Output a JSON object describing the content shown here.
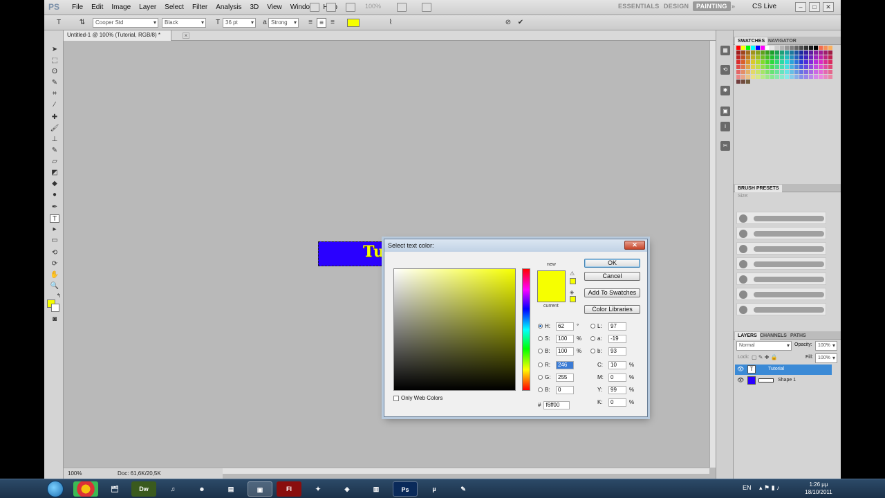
{
  "app": {
    "logo": "PS",
    "menu": [
      "File",
      "Edit",
      "Image",
      "Layer",
      "Select",
      "Filter",
      "Analysis",
      "3D",
      "View",
      "Window",
      "Help"
    ],
    "zoom_menu": "100%",
    "workspaces": [
      "ESSENTIALS",
      "DESIGN",
      "PAINTING"
    ],
    "active_workspace": "PAINTING",
    "cs_live": "CS Live"
  },
  "options_bar": {
    "font_family": "Cooper Std",
    "font_style": "Black",
    "font_size": "36 pt",
    "anti_alias": "Strong",
    "text_color": "#f6ff00"
  },
  "document": {
    "tab_title": "Untitled-1 @ 100% (Tutorial, RGB/8) *",
    "art_text": "Tutorial",
    "art_bg_color": "#2a00ff"
  },
  "status": {
    "zoom": "100%",
    "doc_info": "Doc: 61,6K/20,5K"
  },
  "panels": {
    "swatch_tabs": [
      "SWATCHES",
      "NAVIGATOR"
    ],
    "brush_tab": "BRUSH PRESETS",
    "brush_size_label": "Size:",
    "layer_tabs": [
      "LAYERS",
      "CHANNELS",
      "PATHS"
    ],
    "blend_mode": "Normal",
    "opacity_label": "Opacity:",
    "opacity_value": "100%",
    "lock_label": "Lock:",
    "fill_label": "Fill:",
    "fill_value": "100%",
    "layers": [
      {
        "name": "Tutorial",
        "thumb": "T",
        "selected": true
      },
      {
        "name": "Shape 1",
        "thumb": "",
        "selected": false
      }
    ]
  },
  "dialog": {
    "title": "Select text color:",
    "label_new": "new",
    "label_current": "current",
    "new_color": "#f6ff00",
    "buttons": {
      "ok": "OK",
      "cancel": "Cancel",
      "add_swatches": "Add To Swatches",
      "color_libraries": "Color Libraries"
    },
    "hsb": {
      "h": "62",
      "s": "100",
      "b": "100"
    },
    "rgb": {
      "r": "246",
      "g": "255",
      "b": "0"
    },
    "lab": {
      "l": "97",
      "a": "-19",
      "b": "93"
    },
    "cmyk": {
      "c": "10",
      "m": "0",
      "y": "99",
      "k": "0"
    },
    "hex": "f6ff00",
    "only_web_colors": "Only Web Colors",
    "labels": {
      "h": "H:",
      "s": "S:",
      "b": "B:",
      "r": "R:",
      "g": "G:",
      "b2": "B:",
      "l": "L:",
      "a": "a:",
      "lb": "b:",
      "c": "C:",
      "m": "M:",
      "y": "Y:",
      "k": "K:",
      "hex": "#"
    },
    "units": {
      "deg": "°",
      "pct": "%"
    }
  },
  "taskbar": {
    "apps": [
      "Chrome",
      "Explorer",
      "Dw",
      "iTunes",
      "Game",
      "VB",
      "Window",
      "Fl",
      "Art",
      "Unity",
      "Editor",
      "Ps",
      "uTorrent",
      "Notes"
    ],
    "lang": "EN",
    "time": "1:26 μμ",
    "date": "18/10/2011"
  }
}
